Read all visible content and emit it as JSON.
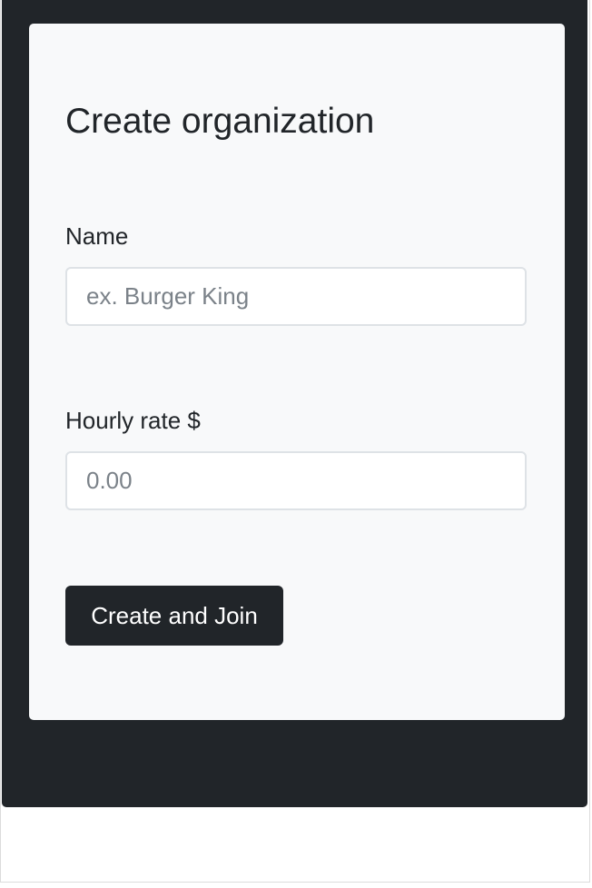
{
  "form": {
    "title": "Create organization",
    "name_label": "Name",
    "name_placeholder": "ex. Burger King",
    "name_value": "",
    "rate_label": "Hourly rate $",
    "rate_placeholder": "0.00",
    "rate_value": "",
    "submit_label": "Create and Join"
  },
  "colors": {
    "panel_background": "#212529",
    "card_background": "#f8f9fa",
    "button_background": "#212529",
    "button_text": "#ffffff",
    "input_border": "#dee2e6",
    "placeholder_text": "#7b8289"
  }
}
